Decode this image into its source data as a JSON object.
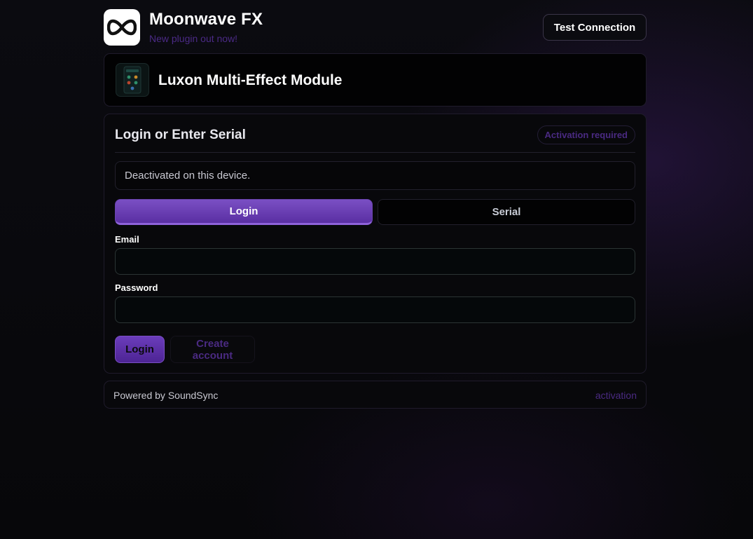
{
  "header": {
    "brand_title": "Moonwave FX",
    "brand_subtitle": "New plugin out now!",
    "logo_icon": "infinity-logo-icon",
    "test_connection_label": "Test Connection"
  },
  "product": {
    "title": "Luxon Multi-Effect Module",
    "thumbnail_icon": "plugin-thumbnail-icon"
  },
  "panel": {
    "title": "Login or Enter Serial",
    "badge": "Activation required",
    "status_message": "Deactivated on this device.",
    "tabs": [
      {
        "label": "Login",
        "active": true
      },
      {
        "label": "Serial",
        "active": false
      }
    ],
    "email_label": "Email",
    "email_value": "",
    "password_label": "Password",
    "password_value": "",
    "login_button": "Login",
    "create_account_button": "Create account"
  },
  "footer": {
    "powered_by": "Powered by SoundSync",
    "link": "activation"
  },
  "colors": {
    "accent": "#6b3dbb",
    "accent_muted": "#4a2a82",
    "background": "#07070a"
  }
}
